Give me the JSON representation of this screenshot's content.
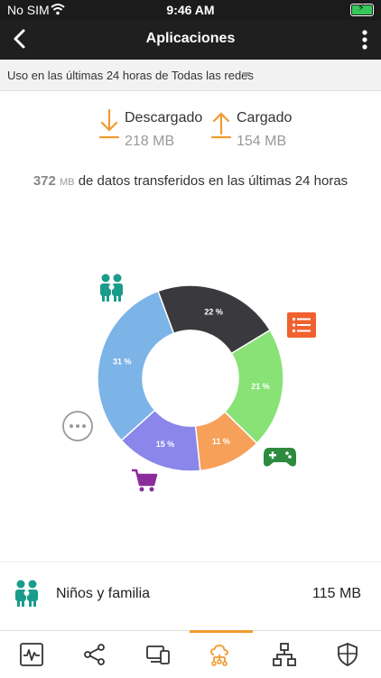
{
  "status_bar": {
    "carrier": "No SIM",
    "time": "9:46 AM"
  },
  "nav": {
    "title": "Aplicaciones"
  },
  "filter": {
    "text": "Uso en las últimas 24 horas de Todas las redes"
  },
  "download": {
    "label": "Descargado",
    "value": "218 MB"
  },
  "upload": {
    "label": "Cargado",
    "value": "154 MB"
  },
  "summary": {
    "amount": "372",
    "unit": "MB",
    "text": "de datos transferidos en las últimas 24 horas"
  },
  "chart_data": {
    "type": "pie",
    "categories": [
      "kids-family",
      "lists",
      "games",
      "shopping",
      "other"
    ],
    "values": [
      31,
      22,
      21,
      11,
      15
    ],
    "labels": [
      "31 %",
      "22 %",
      "21 %",
      "11 %",
      "15 %"
    ],
    "colors": [
      "#7cb4e8",
      "#3a3a3e",
      "#88e276",
      "#f6a05a",
      "#8a86ea"
    ]
  },
  "selected_app": {
    "name": "Niños y familia",
    "size": "115 MB"
  },
  "colors": {
    "accent": "#f29a2e",
    "teal": "#1a9c8c",
    "nav": "#1f1f1f"
  }
}
